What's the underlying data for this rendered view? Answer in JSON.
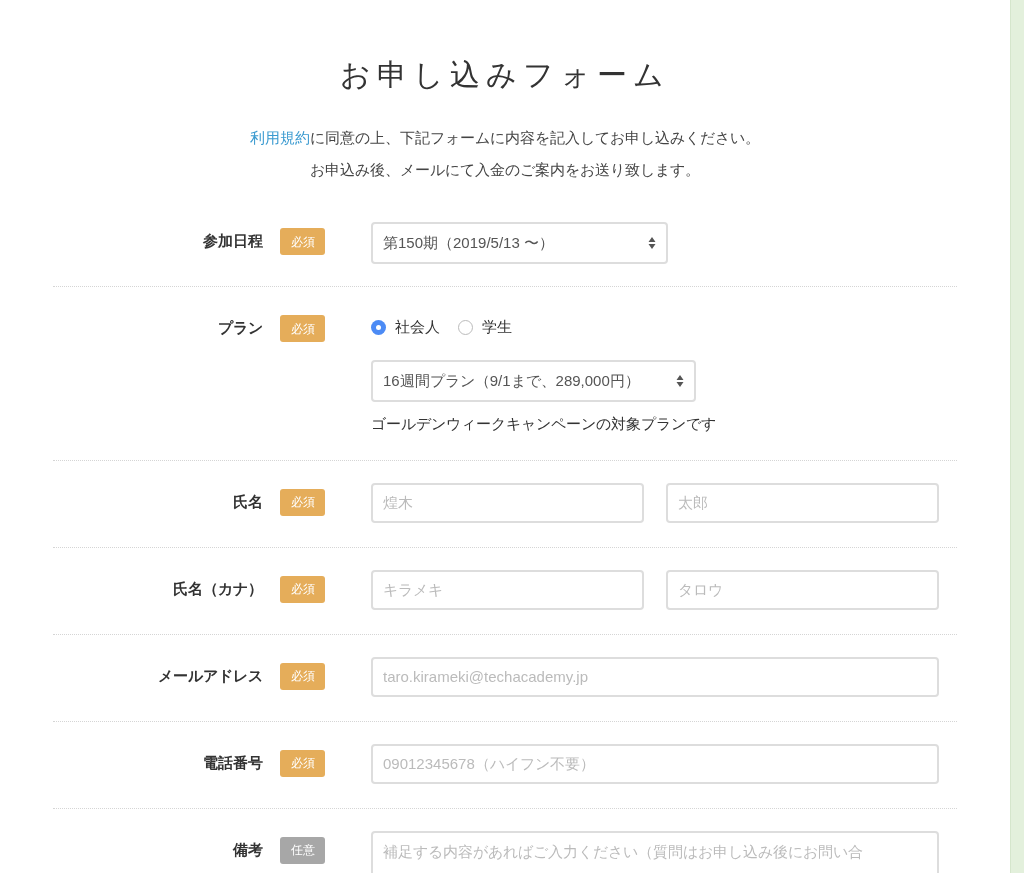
{
  "title": "お申し込みフォーム",
  "intro": {
    "link": "利用規約",
    "text": "に同意の上、下記フォームに内容を記入してお申し込みください。",
    "line2": "お申込み後、メールにて入金のご案内をお送り致します。"
  },
  "rows": [
    {
      "kind": "select",
      "label": "参加日程",
      "badge": "必須",
      "required": true,
      "value": "第150期（2019/5/13 〜）"
    },
    {
      "kind": "plan",
      "label": "プラン",
      "badge": "必須",
      "required": true,
      "options": [
        {
          "label": "社会人",
          "selected": true
        },
        {
          "label": "学生",
          "selected": false
        }
      ],
      "value": "16週間プラン（9/1まで、289,000円）",
      "note": "ゴールデンウィークキャンペーンの対象プランです"
    },
    {
      "kind": "pair",
      "label": "氏名",
      "badge": "必須",
      "required": true,
      "placeholders": [
        "煌木",
        "太郎"
      ]
    },
    {
      "kind": "pair",
      "label": "氏名（カナ）",
      "badge": "必須",
      "required": true,
      "placeholders": [
        "キラメキ",
        "タロウ"
      ]
    },
    {
      "kind": "text",
      "label": "メールアドレス",
      "badge": "必須",
      "required": true,
      "placeholder": "taro.kirameki@techacademy.jp"
    },
    {
      "kind": "text",
      "label": "電話番号",
      "badge": "必須",
      "required": true,
      "placeholder": "09012345678（ハイフン不要）"
    },
    {
      "kind": "textarea",
      "label": "備考",
      "badge": "任意",
      "required": false,
      "placeholder": "補足する内容があればご入力ください（質問はお申し込み後にお問い合"
    }
  ]
}
